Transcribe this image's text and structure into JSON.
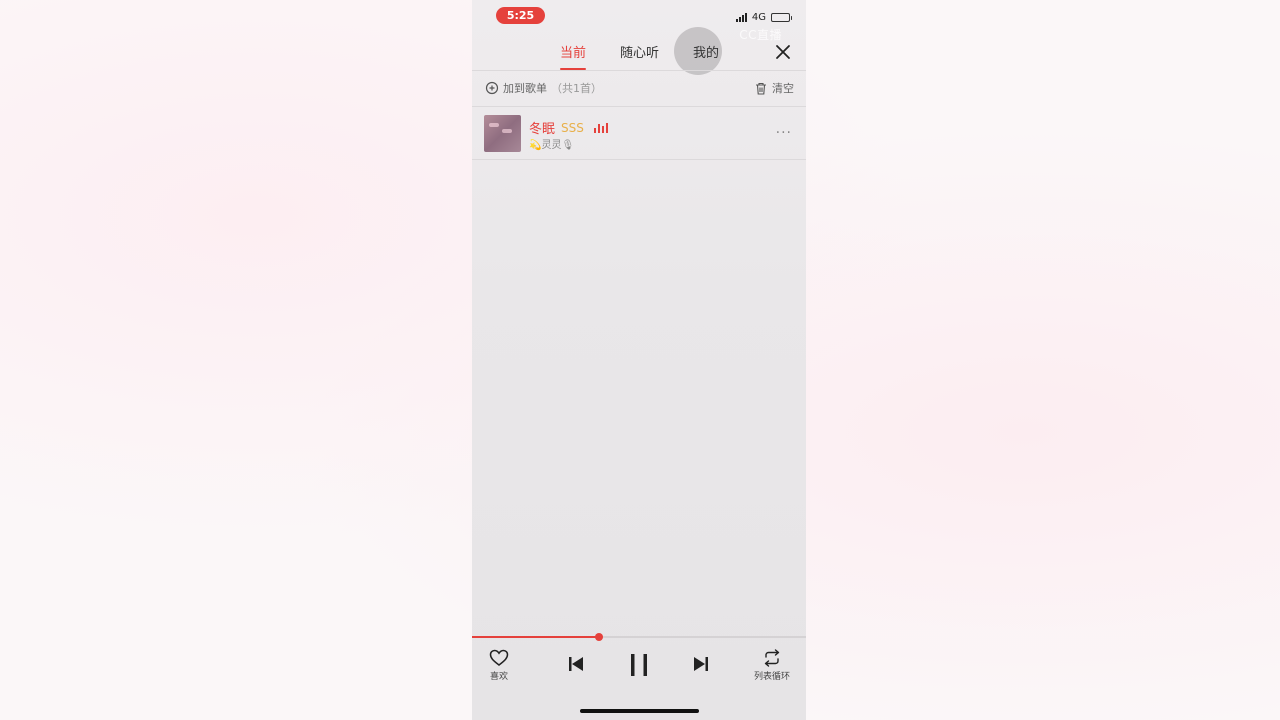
{
  "status_bar": {
    "time": "5:25",
    "network": "4G",
    "watermark": "CC直播"
  },
  "tabs": [
    {
      "label": "当前",
      "active": true
    },
    {
      "label": "随心听",
      "active": false
    },
    {
      "label": "我的",
      "active": false
    }
  ],
  "toolbar": {
    "add_to_playlist": "加到歌单",
    "count": "（共1首）",
    "clear": "清空"
  },
  "playlist": [
    {
      "title": "冬眠",
      "tag": "SSS",
      "artist": "💫灵灵🎙",
      "playing": true
    }
  ],
  "player": {
    "progress": 0.38,
    "like_label": "喜欢",
    "loop_label": "列表循环"
  },
  "colors": {
    "accent": "#e5413c",
    "tag": "#e8b04a",
    "background": "#efecee"
  }
}
